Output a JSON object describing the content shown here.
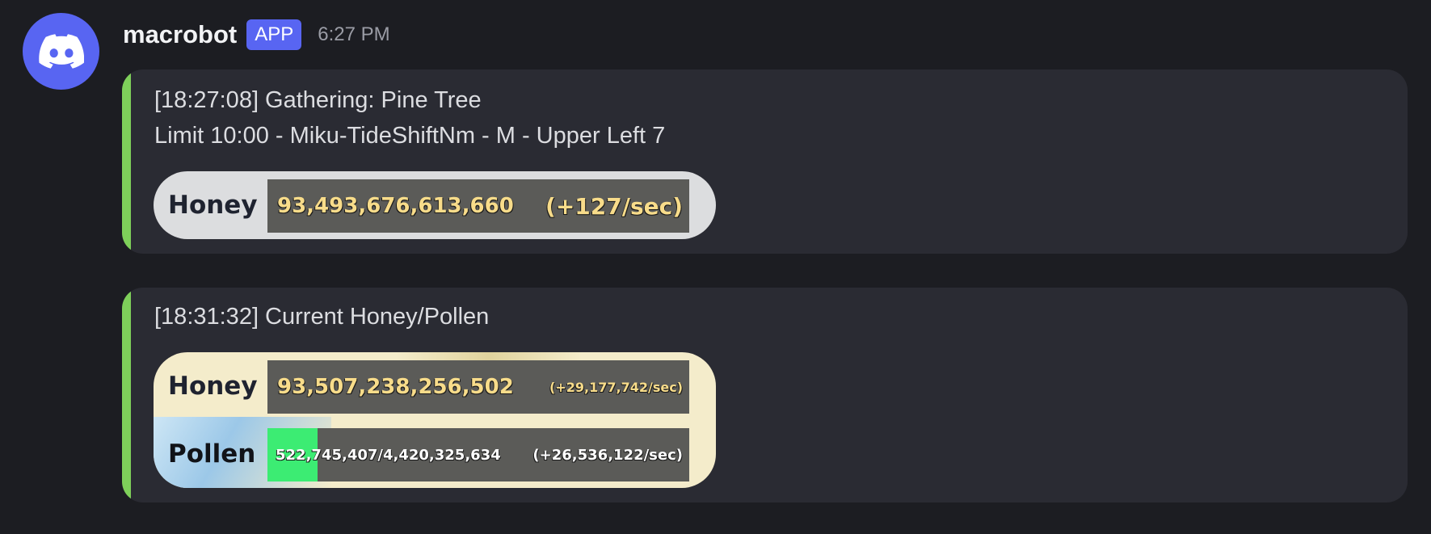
{
  "message": {
    "username": "macrobot",
    "badge": "APP",
    "time": "6:27 PM",
    "avatar_icon": "discord-logo-icon",
    "accent_color": "#5865f2"
  },
  "embeds": [
    {
      "accent_color": "#7ed05a",
      "line1": "[18:27:08] Gathering: Pine Tree",
      "line2": "Limit 10:00 - Miku-TideShiftNm - M - Upper Left 7",
      "image": {
        "honey_label": "Honey",
        "honey_value": "93,493,676,613,660",
        "honey_rate": "(+127/sec)"
      }
    },
    {
      "accent_color": "#7ed05a",
      "line1": "[18:31:32] Current Honey/Pollen",
      "image": {
        "honey_label": "Honey",
        "honey_value": "93,507,238,256,502",
        "honey_rate": "(+29,177,742/sec)",
        "pollen_label": "Pollen",
        "pollen_value": "522,745,407/4,420,325,634",
        "pollen_rate": "(+26,536,122/sec)",
        "pollen_fill_fraction": 0.118
      }
    }
  ]
}
